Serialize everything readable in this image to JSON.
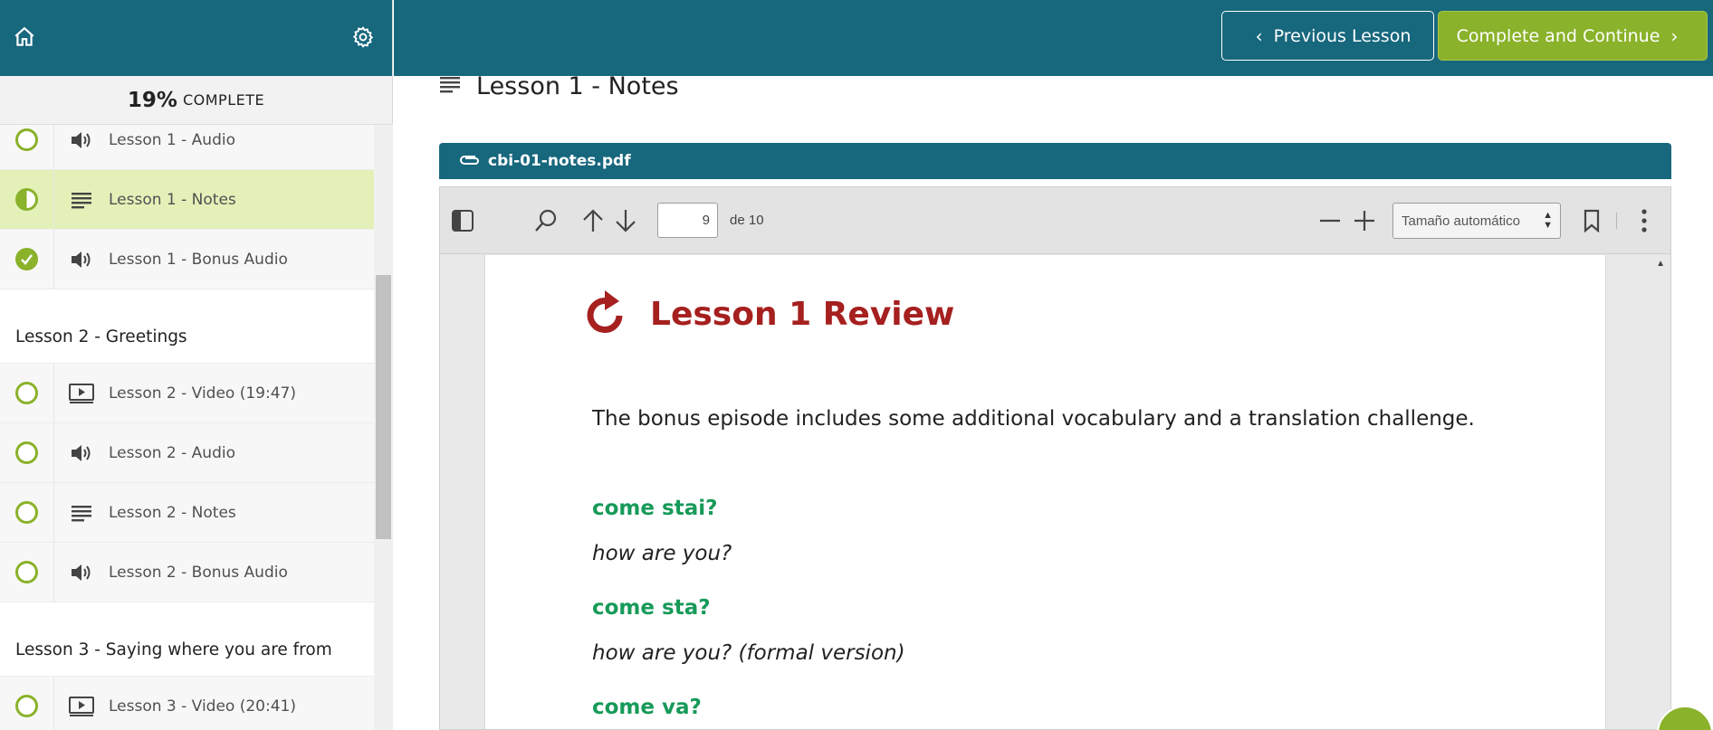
{
  "sidebar": {
    "progress_percent": "19%",
    "progress_label": "COMPLETE",
    "items": [
      {
        "title": "Lesson 1 - Audio",
        "status": "empty",
        "icon": "audio-icon"
      },
      {
        "title": "Lesson 1 - Notes",
        "status": "half",
        "icon": "notes-icon"
      },
      {
        "title": "Lesson 1 - Bonus Audio",
        "status": "done",
        "icon": "audio-icon"
      }
    ],
    "section2": "Lesson 2 - Greetings",
    "items2": [
      {
        "title": "Lesson 2 - Video (19:47)",
        "status": "empty",
        "icon": "video-icon"
      },
      {
        "title": "Lesson 2 - Audio",
        "status": "empty",
        "icon": "audio-icon"
      },
      {
        "title": "Lesson 2 - Notes",
        "status": "empty",
        "icon": "notes-icon"
      },
      {
        "title": "Lesson 2 - Bonus Audio",
        "status": "empty",
        "icon": "audio-icon"
      }
    ],
    "section3": "Lesson 3 - Saying where you are from",
    "items3": [
      {
        "title": "Lesson 3 - Video (20:41)",
        "status": "empty",
        "icon": "video-icon"
      }
    ]
  },
  "header": {
    "prev_label": "Previous Lesson",
    "next_label": "Complete and Continue"
  },
  "main": {
    "title": "Lesson 1 - Notes",
    "file_name": "cbi-01-notes.pdf"
  },
  "viewer": {
    "page_number": "9",
    "page_of": "de 10",
    "zoom": "Tamaño automático"
  },
  "document": {
    "heading": "Lesson 1 Review",
    "intro": "The bonus episode includes some additional vocabulary and a translation challenge.",
    "phrases": [
      {
        "it": "come stai?",
        "en": "how are you?"
      },
      {
        "it": "come sta?",
        "en": "how are you? (formal version)"
      },
      {
        "it": "come va?",
        "en": ""
      }
    ]
  },
  "colors": {
    "brand": "#17677d",
    "accent_green": "#8ab22a",
    "active_row": "#e3f1b9",
    "heading_red": "#a5201f",
    "phrase_green": "#179a59"
  }
}
